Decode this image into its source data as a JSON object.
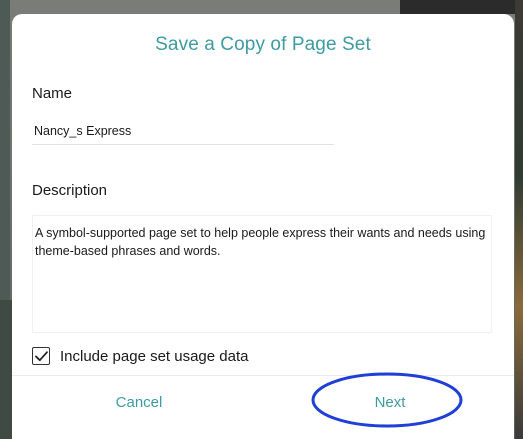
{
  "dialog": {
    "title": "Save a Copy of Page Set",
    "name_label": "Name",
    "name_value": "Nancy_s Express",
    "description_label": "Description",
    "description_value": "A symbol-supported page set to help people express their wants and needs using theme-based phrases and words.",
    "include_usage_label": "Include page set usage data",
    "include_usage_checked": true,
    "cancel_label": "Cancel",
    "next_label": "Next"
  },
  "colors": {
    "accent": "#3e9ba0",
    "annotation_ring": "#1f3fd6",
    "text": "#1a1a1a"
  },
  "icons": {
    "checkbox": "checkmark-icon",
    "annotation": "highlight-ellipse"
  }
}
